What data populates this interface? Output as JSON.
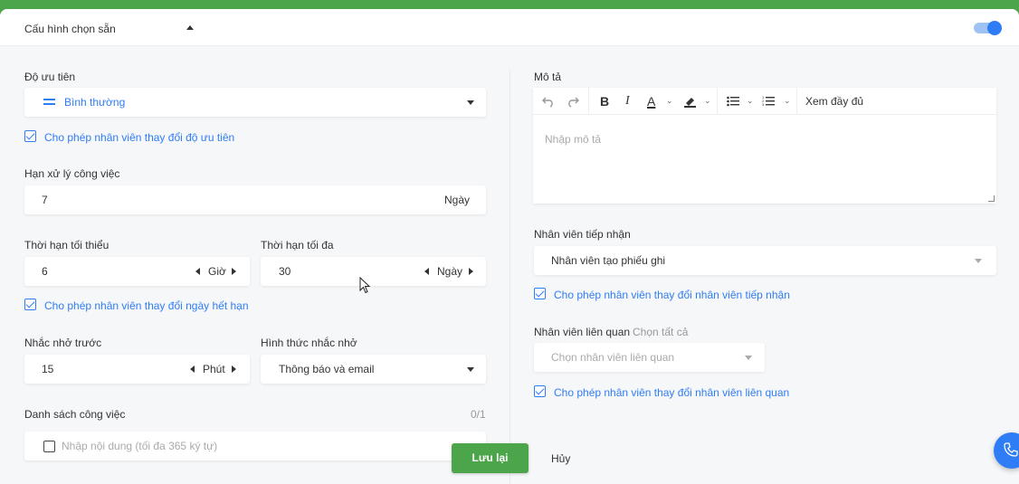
{
  "header": {
    "title": "Cấu hình chọn sẵn"
  },
  "priority": {
    "label": "Độ ưu tiên",
    "value": "Bình thường",
    "allow_change": "Cho phép nhân viên thay đổi độ ưu tiên"
  },
  "deadline": {
    "label": "Hạn xử lý công việc",
    "value": "7",
    "unit": "Ngày"
  },
  "min_time": {
    "label": "Thời hạn tối thiểu",
    "value": "6",
    "unit": "Giờ"
  },
  "max_time": {
    "label": "Thời hạn tối đa",
    "value": "30",
    "unit": "Ngày"
  },
  "allow_deadline": "Cho phép nhân viên thay đổi ngày hết hạn",
  "remind_before": {
    "label": "Nhắc nhở trước",
    "value": "15",
    "unit": "Phút"
  },
  "remind_method": {
    "label": "Hình thức nhắc nhở",
    "value": "Thông báo và email"
  },
  "tasks": {
    "label": "Danh sách công việc",
    "count": "0/1",
    "placeholder": "Nhập nội dung (tối đa 365 ký tự)"
  },
  "description": {
    "label": "Mô tả",
    "placeholder": "Nhập mô tả",
    "toolbar": {
      "bold": "B",
      "italic": "I",
      "font_color": "A",
      "expand": "Xem đầy đủ"
    }
  },
  "receiver": {
    "label": "Nhân viên tiếp nhận",
    "value": "Nhân viên tạo phiếu ghi",
    "allow_change": "Cho phép nhân viên thay đổi nhân viên tiếp nhận"
  },
  "related": {
    "label": "Nhân viên liên quan",
    "select_all": "Chọn tất cả",
    "placeholder": "Chọn nhân viên liên quan",
    "allow_change": "Cho phép nhân viên thay đổi nhân viên liên quan"
  },
  "actions": {
    "save": "Lưu lại",
    "cancel": "Hủy"
  },
  "colors": {
    "accent": "#2f7df6",
    "brand_green": "#4ca54a"
  },
  "icons": [
    "chevron-up-icon",
    "priority-lines-icon",
    "chevron-down-icon",
    "undo-icon",
    "redo-icon",
    "highlighter-icon",
    "bullet-list-icon",
    "numbered-list-icon",
    "phone-icon"
  ]
}
